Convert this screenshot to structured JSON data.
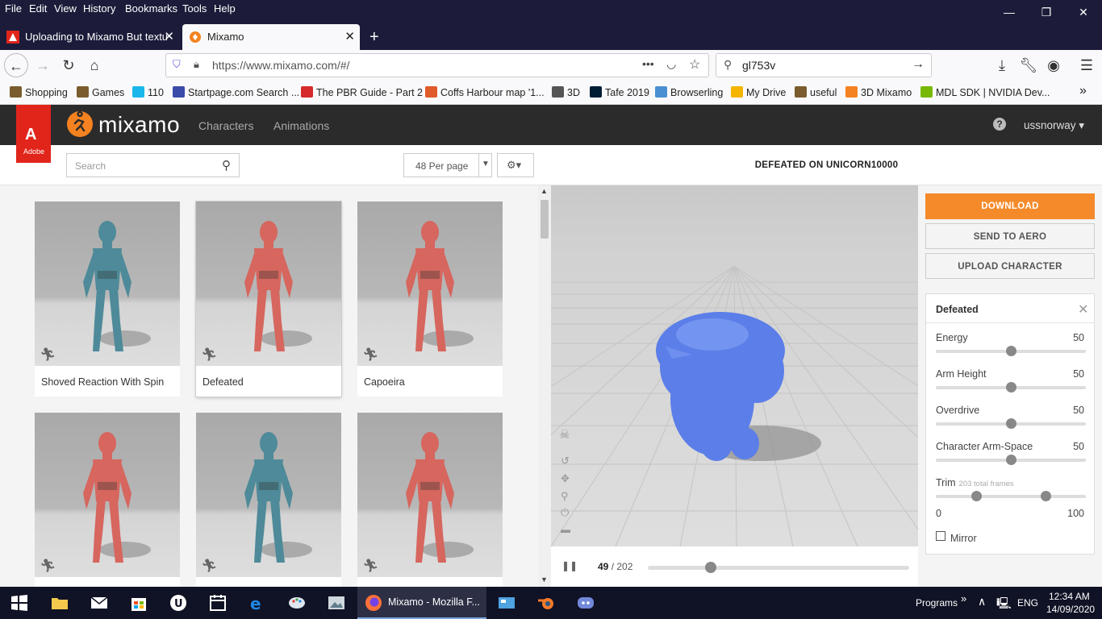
{
  "browser": {
    "menu": [
      "File",
      "Edit",
      "View",
      "History",
      "Bookmarks",
      "Tools",
      "Help"
    ],
    "window_controls": {
      "minimize": "—",
      "restore": "❐",
      "close": "✕"
    },
    "tabs": [
      {
        "title": "Uploading to Mixamo But textu",
        "close": "✕"
      },
      {
        "title": "Mixamo",
        "close": "✕"
      }
    ],
    "new_tab": "+",
    "url": "https://www.mixamo.com/#/",
    "url_actions": "•••",
    "search_value": "gl753v",
    "bookmarks": [
      {
        "label": "Shopping",
        "color": "#7a5c2e"
      },
      {
        "label": "Games",
        "color": "#7a5c2e"
      },
      {
        "label": "110",
        "color": "#1ab7ea"
      },
      {
        "label": "Startpage.com Search ...",
        "color": "#3a4ba8"
      },
      {
        "label": "The PBR Guide - Part 2",
        "color": "#d42a2a"
      },
      {
        "label": "Coffs Harbour map '1...",
        "color": "#e05a2a"
      },
      {
        "label": "3D",
        "color": "#555"
      },
      {
        "label": "Tafe 2019",
        "color": "#001d34"
      },
      {
        "label": "Browserling",
        "color": "#4a8fd1"
      },
      {
        "label": "My Drive",
        "color": "#f4b400"
      },
      {
        "label": "useful",
        "color": "#7a5c2e"
      },
      {
        "label": "3D Mixamo",
        "color": "#f58220"
      },
      {
        "label": "MDL SDK | NVIDIA Dev...",
        "color": "#76b900"
      }
    ],
    "bookmarks_overflow": "»"
  },
  "mixamo": {
    "adobe_letter": "A",
    "adobe_word": "Adobe",
    "logo_text": "mixamo",
    "nav": [
      "Characters",
      "Animations"
    ],
    "help": "?",
    "username": "ussnorway ▾",
    "search_placeholder": "Search",
    "per_page": "48 Per page",
    "gear": "⚙▾",
    "cards": [
      {
        "label": "Shoved Reaction With Spin",
        "figure_color": "#4e8a99"
      },
      {
        "label": "Defeated",
        "figure_color": "#d6665e"
      },
      {
        "label": "Capoeira",
        "figure_color": "#d6665e"
      },
      {
        "label": "",
        "figure_color": "#d6665e"
      },
      {
        "label": "",
        "figure_color": "#4e8a99"
      },
      {
        "label": "",
        "figure_color": "#d6665e"
      }
    ],
    "animation_title": "DEFEATED ON UNICORN10000",
    "buttons": {
      "download": "DOWNLOAD",
      "send_to_aero": "SEND TO AERO",
      "upload_character": "UPLOAD CHARACTER"
    },
    "settings": {
      "name": "Defeated",
      "close": "✕",
      "sliders": [
        {
          "label": "Energy",
          "value": "50",
          "level": 0.5
        },
        {
          "label": "Arm Height",
          "value": "50",
          "level": 0.5
        },
        {
          "label": "Overdrive",
          "value": "50",
          "level": 0.5
        },
        {
          "label": "Character Arm-Space",
          "value": "50",
          "level": 0.5
        }
      ],
      "trim": {
        "label": "Trim",
        "subtitle": "203 total frames",
        "min_label": "0",
        "max_label": "100",
        "start": 0.27,
        "end": 0.73
      },
      "mirror": "Mirror"
    },
    "player": {
      "current_frame": "49",
      "total_frames": "/ 202",
      "pause": "❚❚",
      "progress": 0.24
    },
    "colors": {
      "accent": "#f58a2a",
      "header": "#2b2b2b",
      "character": "#5b7ee8"
    }
  },
  "taskbar": {
    "active_window": "Mixamo - Mozilla F...",
    "programs": "Programs",
    "chevron": "»",
    "language": "ENG",
    "time": "12:34 AM",
    "date": "14/09/2020"
  }
}
